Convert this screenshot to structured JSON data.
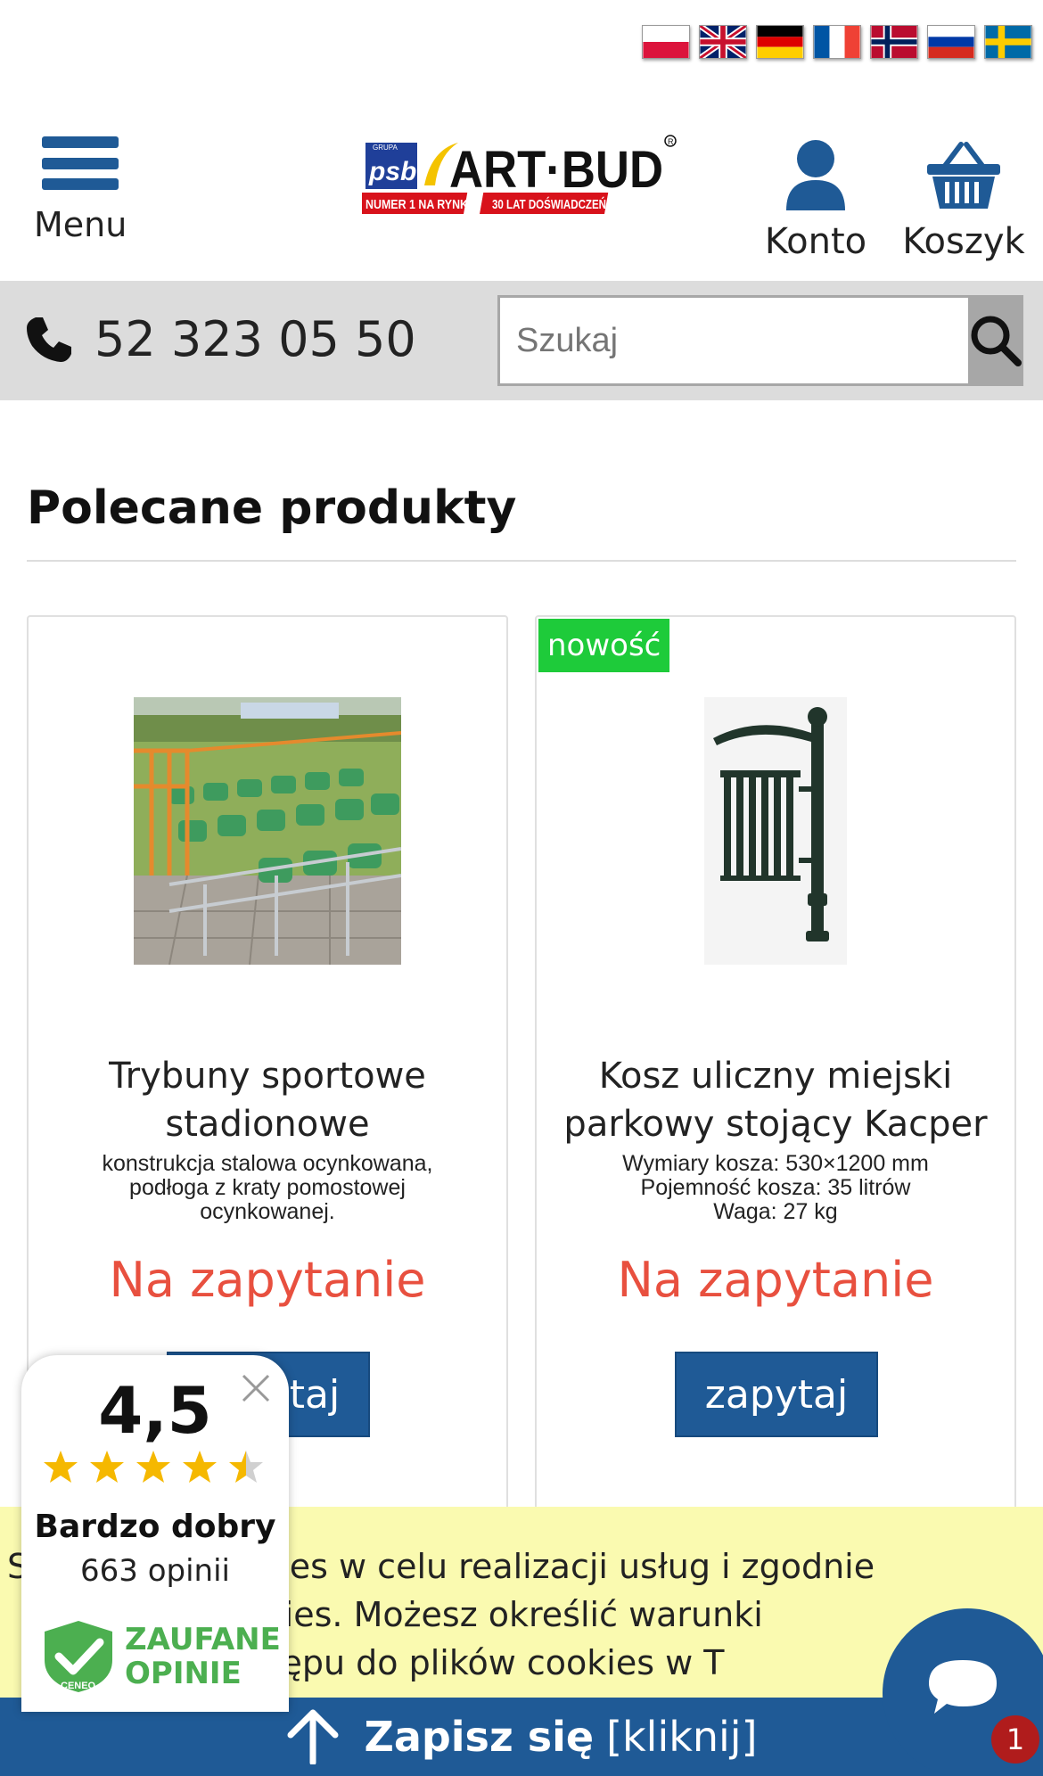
{
  "languages": [
    {
      "code": "pl",
      "name": "Polski"
    },
    {
      "code": "en",
      "name": "English"
    },
    {
      "code": "de",
      "name": "Deutsch"
    },
    {
      "code": "fr",
      "name": "Français"
    },
    {
      "code": "no",
      "name": "Norsk"
    },
    {
      "code": "ru",
      "name": "Русский"
    },
    {
      "code": "sv",
      "name": "Svenska"
    }
  ],
  "header": {
    "menu_label": "Menu",
    "logo": {
      "psb": "psb",
      "brand": "ART·BUD",
      "tag_left": "NUMER 1 NA RYNKU",
      "tag_right": "30 LAT DOŚWIADCZEŃ",
      "grupa": "GRUPA"
    },
    "account_label": "Konto",
    "cart_label": "Koszyk"
  },
  "contact": {
    "phone": "52 323 05 50"
  },
  "search": {
    "placeholder": "Szukaj"
  },
  "section": {
    "title": "Polecane produkty"
  },
  "products": [
    {
      "name": "Trybuny sportowe stadionowe",
      "description": "konstrukcja stalowa ocynkowana, podłoga z kraty pomostowej ocynkowanej.",
      "price": "Na zapytanie",
      "button": "zapytaj",
      "badge": ""
    },
    {
      "name": "Kosz uliczny miejski parkowy stojący Kacper",
      "description": "Wymiary kosza: 530×1200 mm\nPojemność kosza: 35 litrów\nWaga: 27 kg",
      "price": "Na zapytanie",
      "button": "zapytaj",
      "badge": "nowość"
    }
  ],
  "cookie": {
    "text": "S     plików cookies w celu realizacji usług i zgodnie\n       Plików Cookies. Możesz określić warunki\n       nia lub dostępu do plików cookies w T"
  },
  "subscribe": {
    "main": "Zapisz się",
    "extra": "[kliknij]"
  },
  "rating": {
    "score": "4,5",
    "stars": 4.5,
    "label": "Bardzo dobry",
    "count": "663 opinii",
    "badge_line1": "ZAUFANE",
    "badge_line2": "OPINIE",
    "badge_brand": "CENEO"
  },
  "chat": {
    "unread": "1"
  },
  "colors": {
    "primary": "#1f5a96",
    "price": "#e8503f",
    "new_badge": "#1ecb3a",
    "cookie_bg": "#fafab0",
    "bar_bg": "#dcdcdc",
    "rating_green": "#4caf50",
    "star": "#f5b800"
  }
}
